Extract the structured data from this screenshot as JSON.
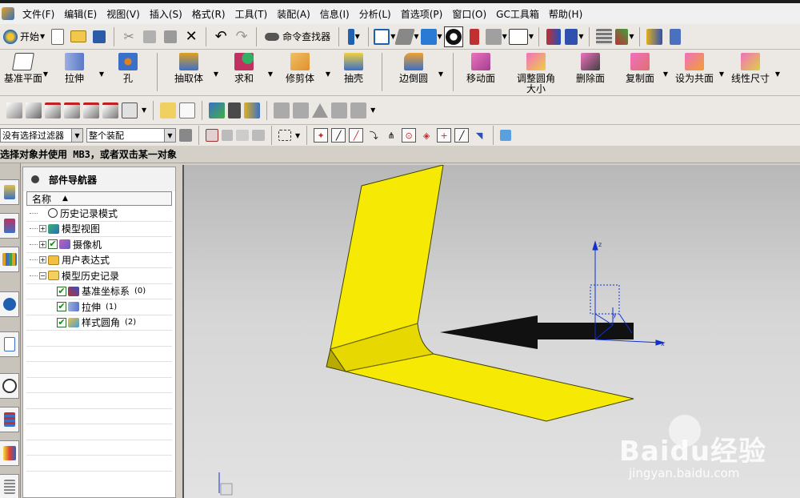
{
  "menubar": {
    "items": [
      "文件(F)",
      "编辑(E)",
      "视图(V)",
      "插入(S)",
      "格式(R)",
      "工具(T)",
      "装配(A)",
      "信息(I)",
      "分析(L)",
      "首选项(P)",
      "窗口(O)",
      "GC工具箱",
      "帮助(H)"
    ]
  },
  "toolbar1": {
    "start_label": "开始",
    "command_finder_label": "命令查找器"
  },
  "toolbar2": {
    "buttons": [
      {
        "label": "基准平面",
        "icon": "datum-plane-icon"
      },
      {
        "label": "拉伸",
        "icon": "extrude-icon"
      },
      {
        "label": "孔",
        "icon": "hole-icon"
      },
      {
        "label": "抽取体",
        "icon": "extract-body-icon"
      },
      {
        "label": "求和",
        "icon": "unite-icon"
      },
      {
        "label": "修剪体",
        "icon": "trim-body-icon"
      },
      {
        "label": "抽壳",
        "icon": "shell-icon"
      },
      {
        "label": "边倒圆",
        "icon": "edge-blend-icon"
      },
      {
        "label": "移动面",
        "icon": "move-face-icon"
      },
      {
        "label": "调整圆角大小",
        "icon": "resize-blend-icon"
      },
      {
        "label": "删除面",
        "icon": "delete-face-icon"
      },
      {
        "label": "复制面",
        "icon": "copy-face-icon"
      },
      {
        "label": "设为共面",
        "icon": "make-coplanar-icon"
      },
      {
        "label": "线性尺寸",
        "icon": "linear-dimension-icon"
      }
    ]
  },
  "selection_bar": {
    "filter_value": "没有选择过滤器",
    "scope_value": "整个装配"
  },
  "cue_line": "选择对象并使用 MB3，或者双击某一对象",
  "navigator": {
    "title": "部件导航器",
    "column_header": "名称",
    "rows": [
      {
        "label": "历史记录模式",
        "level": 0,
        "expander": "",
        "checked": false,
        "icon": "clock-icon",
        "suffix": ""
      },
      {
        "label": "模型视图",
        "level": 0,
        "expander": "+",
        "checked": false,
        "icon": "model-view-icon",
        "suffix": ""
      },
      {
        "label": "摄像机",
        "level": 0,
        "expander": "+",
        "checked": true,
        "icon": "camera-icon",
        "suffix": ""
      },
      {
        "label": "用户表达式",
        "level": 0,
        "expander": "+",
        "checked": false,
        "icon": "folder-icon",
        "suffix": ""
      },
      {
        "label": "模型历史记录",
        "level": 0,
        "expander": "−",
        "checked": false,
        "icon": "folder-open-icon",
        "suffix": ""
      },
      {
        "label": "基准坐标系",
        "level": 1,
        "expander": "",
        "checked": true,
        "icon": "csys-icon",
        "suffix": "(0)"
      },
      {
        "label": "拉伸",
        "level": 1,
        "expander": "",
        "checked": true,
        "icon": "extrude-icon",
        "suffix": "(1)"
      },
      {
        "label": "样式圆角",
        "level": 1,
        "expander": "",
        "checked": true,
        "icon": "styled-blend-icon",
        "suffix": "(2)"
      }
    ]
  },
  "watermark": {
    "brand": "Baidu经验",
    "url": "jingyan.baidu.com"
  },
  "viewport": {
    "triad_labels": [
      "z",
      "x",
      "y"
    ]
  }
}
